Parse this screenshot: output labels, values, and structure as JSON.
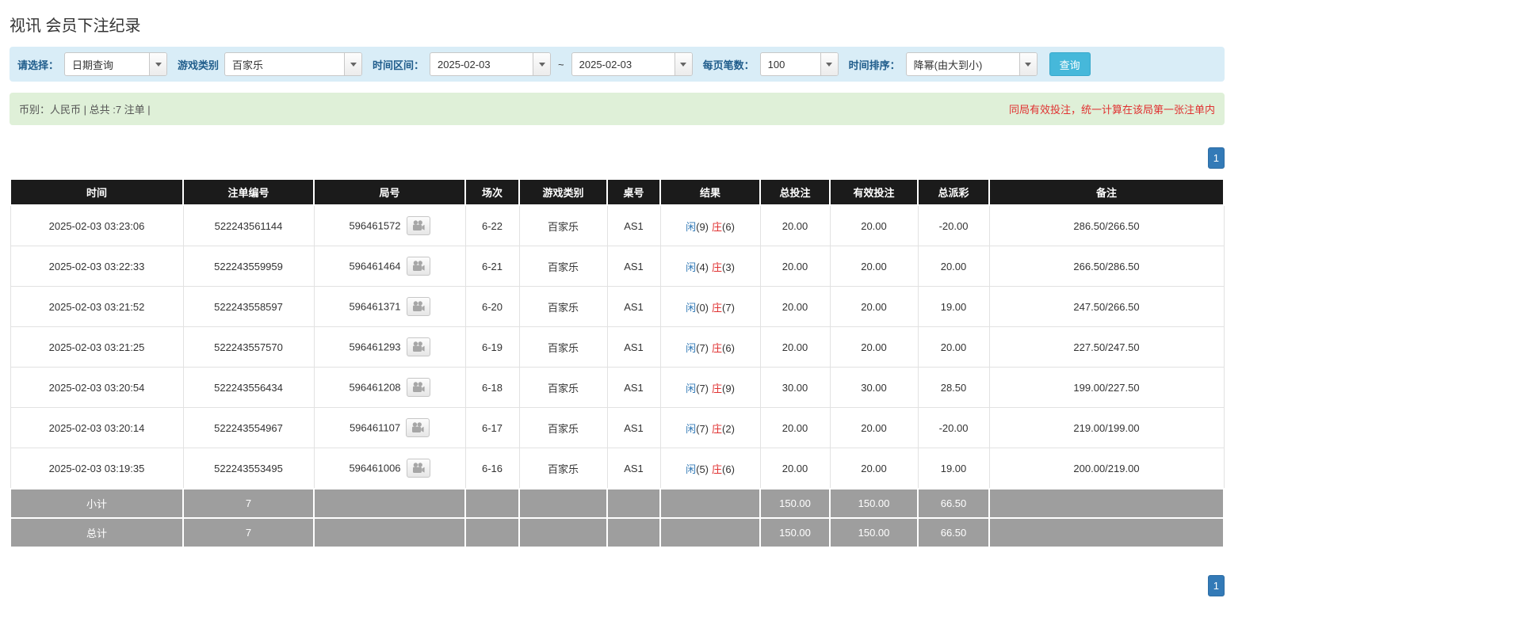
{
  "page": {
    "title": "视讯 会员下注纪录"
  },
  "filters": {
    "select_label": "请选择：",
    "select_value": "日期查询",
    "game_type_label": "游戏类别",
    "game_type_value": "百家乐",
    "date_range_label": "时间区间：",
    "date_from": "2025-02-03",
    "date_separator": "~",
    "date_to": "2025-02-03",
    "page_size_label": "每页笔数：",
    "page_size_value": "100",
    "sort_label": "时间排序：",
    "sort_value": "降幂(由大到小)",
    "search_button": "查询"
  },
  "summary": {
    "left": "币别：人民币 | 总共 :7 注单 |",
    "right": "同局有效投注，统一计算在该局第一张注单内"
  },
  "pagination": {
    "page": "1"
  },
  "table": {
    "headers": [
      "时间",
      "注单编号",
      "局号",
      "场次",
      "游戏类别",
      "桌号",
      "结果",
      "总投注",
      "有效投注",
      "总派彩",
      "备注"
    ],
    "rows": [
      {
        "time": "2025-02-03 03:23:06",
        "bet_id": "522243561144",
        "round_id": "596461572",
        "session": "6-22",
        "game": "百家乐",
        "table_no": "AS1",
        "player": "闲",
        "player_score": "(9)",
        "banker": "庄",
        "banker_score": "(6)",
        "total_bet": "20.00",
        "valid_bet": "20.00",
        "payout": "-20.00",
        "remark": "286.50/266.50"
      },
      {
        "time": "2025-02-03 03:22:33",
        "bet_id": "522243559959",
        "round_id": "596461464",
        "session": "6-21",
        "game": "百家乐",
        "table_no": "AS1",
        "player": "闲",
        "player_score": "(4)",
        "banker": "庄",
        "banker_score": "(3)",
        "total_bet": "20.00",
        "valid_bet": "20.00",
        "payout": "20.00",
        "remark": "266.50/286.50"
      },
      {
        "time": "2025-02-03 03:21:52",
        "bet_id": "522243558597",
        "round_id": "596461371",
        "session": "6-20",
        "game": "百家乐",
        "table_no": "AS1",
        "player": "闲",
        "player_score": "(0)",
        "banker": "庄",
        "banker_score": "(7)",
        "total_bet": "20.00",
        "valid_bet": "20.00",
        "payout": "19.00",
        "remark": "247.50/266.50"
      },
      {
        "time": "2025-02-03 03:21:25",
        "bet_id": "522243557570",
        "round_id": "596461293",
        "session": "6-19",
        "game": "百家乐",
        "table_no": "AS1",
        "player": "闲",
        "player_score": "(7)",
        "banker": "庄",
        "banker_score": "(6)",
        "total_bet": "20.00",
        "valid_bet": "20.00",
        "payout": "20.00",
        "remark": "227.50/247.50"
      },
      {
        "time": "2025-02-03 03:20:54",
        "bet_id": "522243556434",
        "round_id": "596461208",
        "session": "6-18",
        "game": "百家乐",
        "table_no": "AS1",
        "player": "闲",
        "player_score": "(7)",
        "banker": "庄",
        "banker_score": "(9)",
        "total_bet": "30.00",
        "valid_bet": "30.00",
        "payout": "28.50",
        "remark": "199.00/227.50"
      },
      {
        "time": "2025-02-03 03:20:14",
        "bet_id": "522243554967",
        "round_id": "596461107",
        "session": "6-17",
        "game": "百家乐",
        "table_no": "AS1",
        "player": "闲",
        "player_score": "(7)",
        "banker": "庄",
        "banker_score": "(2)",
        "total_bet": "20.00",
        "valid_bet": "20.00",
        "payout": "-20.00",
        "remark": "219.00/199.00"
      },
      {
        "time": "2025-02-03 03:19:35",
        "bet_id": "522243553495",
        "round_id": "596461006",
        "session": "6-16",
        "game": "百家乐",
        "table_no": "AS1",
        "player": "闲",
        "player_score": "(5)",
        "banker": "庄",
        "banker_score": "(6)",
        "total_bet": "20.00",
        "valid_bet": "20.00",
        "payout": "19.00",
        "remark": "200.00/219.00"
      }
    ],
    "subtotal": {
      "label": "小计",
      "count": "7",
      "total_bet": "150.00",
      "valid_bet": "150.00",
      "payout": "66.50"
    },
    "total": {
      "label": "总计",
      "count": "7",
      "total_bet": "150.00",
      "valid_bet": "150.00",
      "payout": "66.50"
    }
  },
  "colors": {
    "accent_blue": "#337ab7",
    "banker_red": "#e03131",
    "header_black": "#1b1b1b",
    "footer_gray": "#9e9e9e",
    "filter_bg": "#d9edf7",
    "summary_bg": "#dff0d8",
    "search_btn": "#46b8da"
  }
}
